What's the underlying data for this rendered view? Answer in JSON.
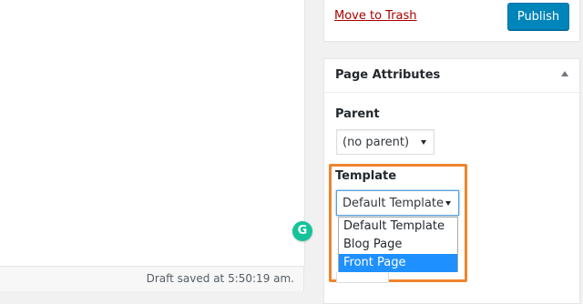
{
  "status_bar": {
    "draft_status": "Draft saved at 5:50:19 am."
  },
  "publish": {
    "trash_label": "Move to Trash",
    "publish_label": "Publish"
  },
  "page_attributes": {
    "title": "Page Attributes",
    "parent_label": "Parent",
    "parent_value": "(no parent)",
    "template_label": "Template",
    "template_value": "Default Template",
    "template_options": [
      "Default Template",
      "Blog Page",
      "Front Page"
    ],
    "highlighted_option": "Front Page"
  },
  "grammarly": {
    "glyph": "G"
  },
  "colors": {
    "publish_button": "#0085ba",
    "trash_link": "#aa0000",
    "highlight_box": "#f0842b",
    "selected_option": "#1e90ff",
    "grammarly": "#15c39a"
  }
}
